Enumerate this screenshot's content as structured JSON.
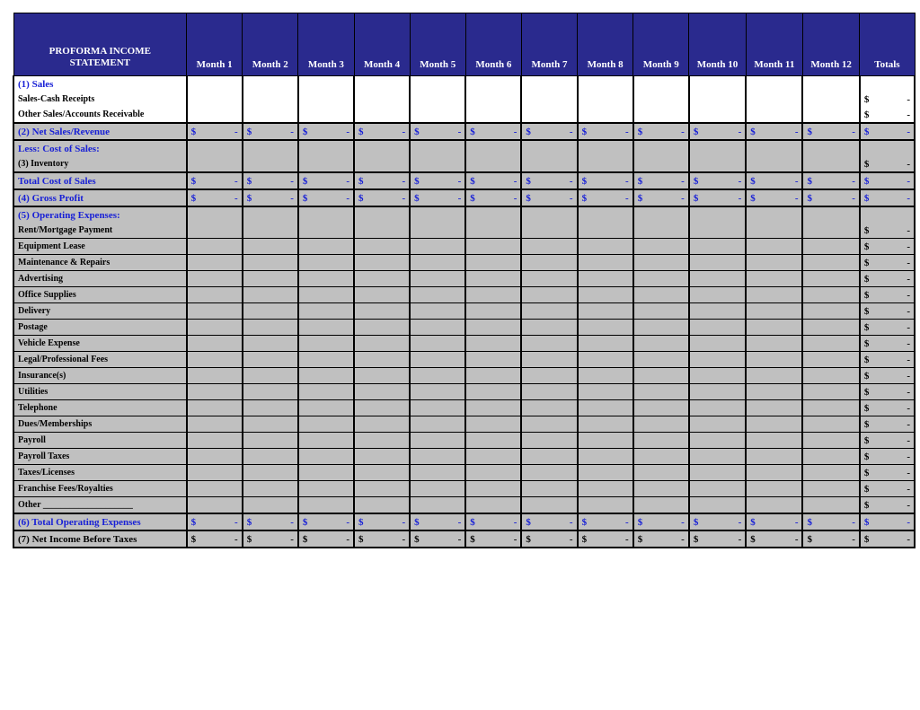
{
  "title_line1": "PROFORMA INCOME",
  "title_line2": "STATEMENT",
  "months": [
    "Month 1",
    "Month 2",
    "Month 3",
    "Month 4",
    "Month 5",
    "Month 6",
    "Month 7",
    "Month 8",
    "Month 9",
    "Month 10",
    "Month 11",
    "Month 12"
  ],
  "totals_label": "Totals",
  "dollar": "$",
  "dash": "-",
  "rows": [
    {
      "label": "(1) Sales",
      "style": "blue"
    },
    {
      "label": "Sales-Cash Receipts",
      "style": "bold indent small",
      "total": true
    },
    {
      "label": "Other Sales/Accounts Receivable",
      "style": "bold indent small",
      "total": true
    },
    {
      "label": "(2) Net Sales/Revenue",
      "style": "grey blue btop bbot",
      "months": true,
      "total": true
    },
    {
      "label": "Less: Cost of Sales:",
      "style": "grey blue"
    },
    {
      "label": "(3) Inventory",
      "style": "grey bold small",
      "total": true
    },
    {
      "label": "Total Cost of Sales",
      "style": "grey blue btop bbot",
      "months": true,
      "total": true
    },
    {
      "label": "(4) Gross Profit",
      "style": "grey blue bbot",
      "months": true,
      "total": true
    },
    {
      "label": "(5) Operating Expenses:",
      "style": "grey blue"
    },
    {
      "label": "Rent/Mortgage Payment",
      "style": "grey bold small thin",
      "total": true
    },
    {
      "label": "Equipment Lease",
      "style": "grey bold small thin",
      "total": true
    },
    {
      "label": "Maintenance & Repairs",
      "style": "grey bold small thin",
      "total": true
    },
    {
      "label": "Advertising",
      "style": "grey bold small thin",
      "total": true
    },
    {
      "label": "Office Supplies",
      "style": "grey bold small thin",
      "total": true
    },
    {
      "label": "Delivery",
      "style": "grey bold small thin",
      "total": true
    },
    {
      "label": "Postage",
      "style": "grey bold small thin",
      "total": true
    },
    {
      "label": "Vehicle Expense",
      "style": "grey bold small thin",
      "total": true
    },
    {
      "label": "Legal/Professional Fees",
      "style": "grey bold small thin",
      "total": true
    },
    {
      "label": "Insurance(s)",
      "style": "grey bold small thin",
      "total": true
    },
    {
      "label": "Utilities",
      "style": "grey bold small thin",
      "total": true
    },
    {
      "label": "Telephone",
      "style": "grey bold small thin",
      "total": true
    },
    {
      "label": "Dues/Memberships",
      "style": "grey bold small thin",
      "total": true
    },
    {
      "label": "Payroll",
      "style": "grey bold small thin",
      "total": true
    },
    {
      "label": "Payroll Taxes",
      "style": "grey bold small thin",
      "total": true
    },
    {
      "label": "Taxes/Licenses",
      "style": "grey bold small thin",
      "total": true
    },
    {
      "label": "Franchise Fees/Royalties",
      "style": "grey bold small thin",
      "total": true
    },
    {
      "label": "Other ____________________",
      "style": "grey bold small",
      "total": true
    },
    {
      "label": "(6) Total Operating Expenses",
      "style": "grey blue btop bbot",
      "months": true,
      "total": true
    },
    {
      "label": "(7) Net Income Before Taxes",
      "style": "grey bold bbot",
      "months": true,
      "total": true,
      "black": true
    }
  ]
}
